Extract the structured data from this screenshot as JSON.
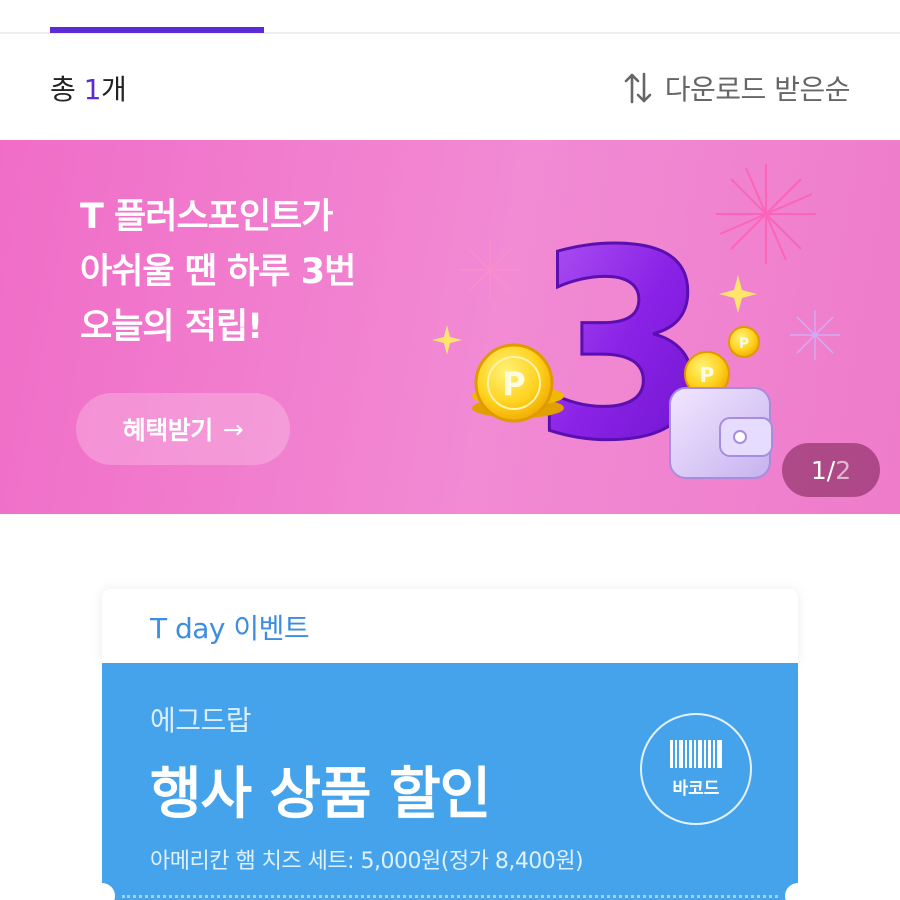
{
  "list_header": {
    "total_prefix": "총 ",
    "total_number": "1",
    "total_suffix": "개",
    "sort_label": "다운로드 받은순"
  },
  "banner": {
    "title_lines": [
      "T 플러스포인트가",
      "아쉬울 땐 하루 3번",
      "오늘의 적립!"
    ],
    "cta_label": "혜택받기",
    "cta_arrow": "→",
    "art_numeral": "3",
    "coin_mark": "P",
    "pager_current": "1",
    "pager_sep": "/",
    "pager_total": "2"
  },
  "coupon": {
    "tag": "T day 이벤트",
    "brand": "에그드랍",
    "title": "행사 상품 할인",
    "description": "아메리칸 햄 치즈 세트: 5,000원(정가 8,400원)",
    "barcode_label": "바코드"
  },
  "colors": {
    "accent_purple": "#5b2bd6",
    "banner_pink": "#f06dc7",
    "coupon_blue": "#45a3ec",
    "coupon_tag_blue": "#3d8ee0"
  },
  "icons": [
    "sort-icon",
    "arrow-right-icon",
    "barcode-icon",
    "coin-icon",
    "wallet-icon",
    "firework-icon",
    "sparkle-icon"
  ]
}
